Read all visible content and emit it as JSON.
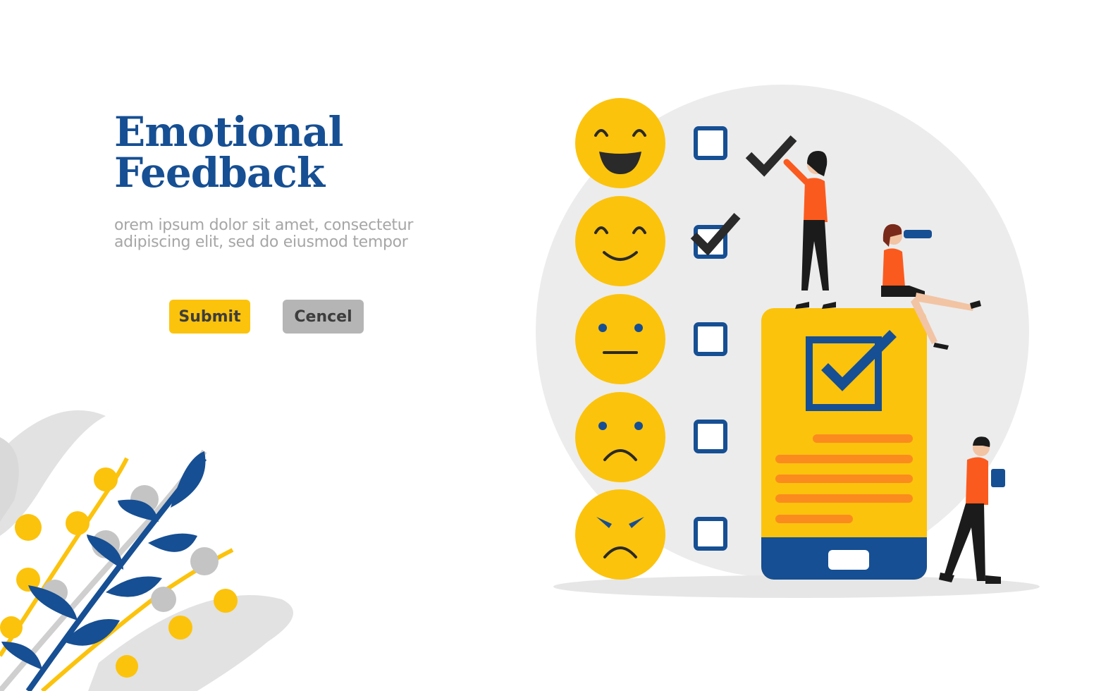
{
  "hero": {
    "title_line1": "Emotional",
    "title_line2": "Feedback",
    "subtitle_line1": "orem ipsum dolor sit amet, consectetur",
    "subtitle_line2": "adipiscing elit, sed do eiusmod tempor"
  },
  "actions": {
    "submit_label": "Submit",
    "cancel_label": "Cencel"
  },
  "rating": {
    "options": [
      {
        "emoji": "laughing-face",
        "checked": false
      },
      {
        "emoji": "smiling-face",
        "checked": true
      },
      {
        "emoji": "neutral-face",
        "checked": false
      },
      {
        "emoji": "sad-face",
        "checked": false
      },
      {
        "emoji": "angry-face",
        "checked": false
      }
    ]
  },
  "colors": {
    "brand_blue": "#164f93",
    "accent_yellow": "#fcc30c",
    "orange": "#fb8b1e",
    "grey": "#b5b5b5",
    "bg_circle": "#ececec"
  }
}
